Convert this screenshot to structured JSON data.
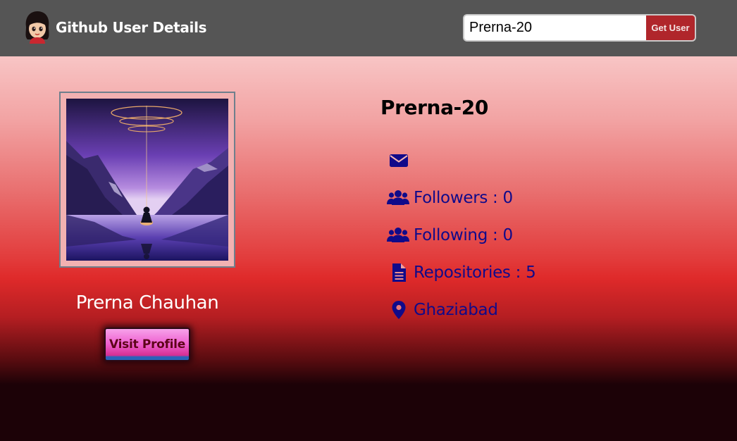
{
  "navbar": {
    "title": "Github User Details",
    "logo_icon": "girl-avatar-logo-icon",
    "search": {
      "value": "Prerna-20",
      "button_label": "Get User"
    },
    "background": "#555555",
    "button_color": "#b0262b"
  },
  "profile": {
    "avatar_icon": "purple-mountain-lake-meditation-image",
    "full_name": "Prerna Chauhan",
    "visit_label": "Visit Profile",
    "username": "Prerna-20"
  },
  "details": {
    "email_icon": "envelope-icon",
    "followers_label": "Followers",
    "followers_count": "0",
    "following_label": "Following",
    "following_count": "0",
    "repos_label": "Repositories",
    "repos_count": "5",
    "location": "Ghaziabad",
    "text_color": "#100a8a"
  }
}
